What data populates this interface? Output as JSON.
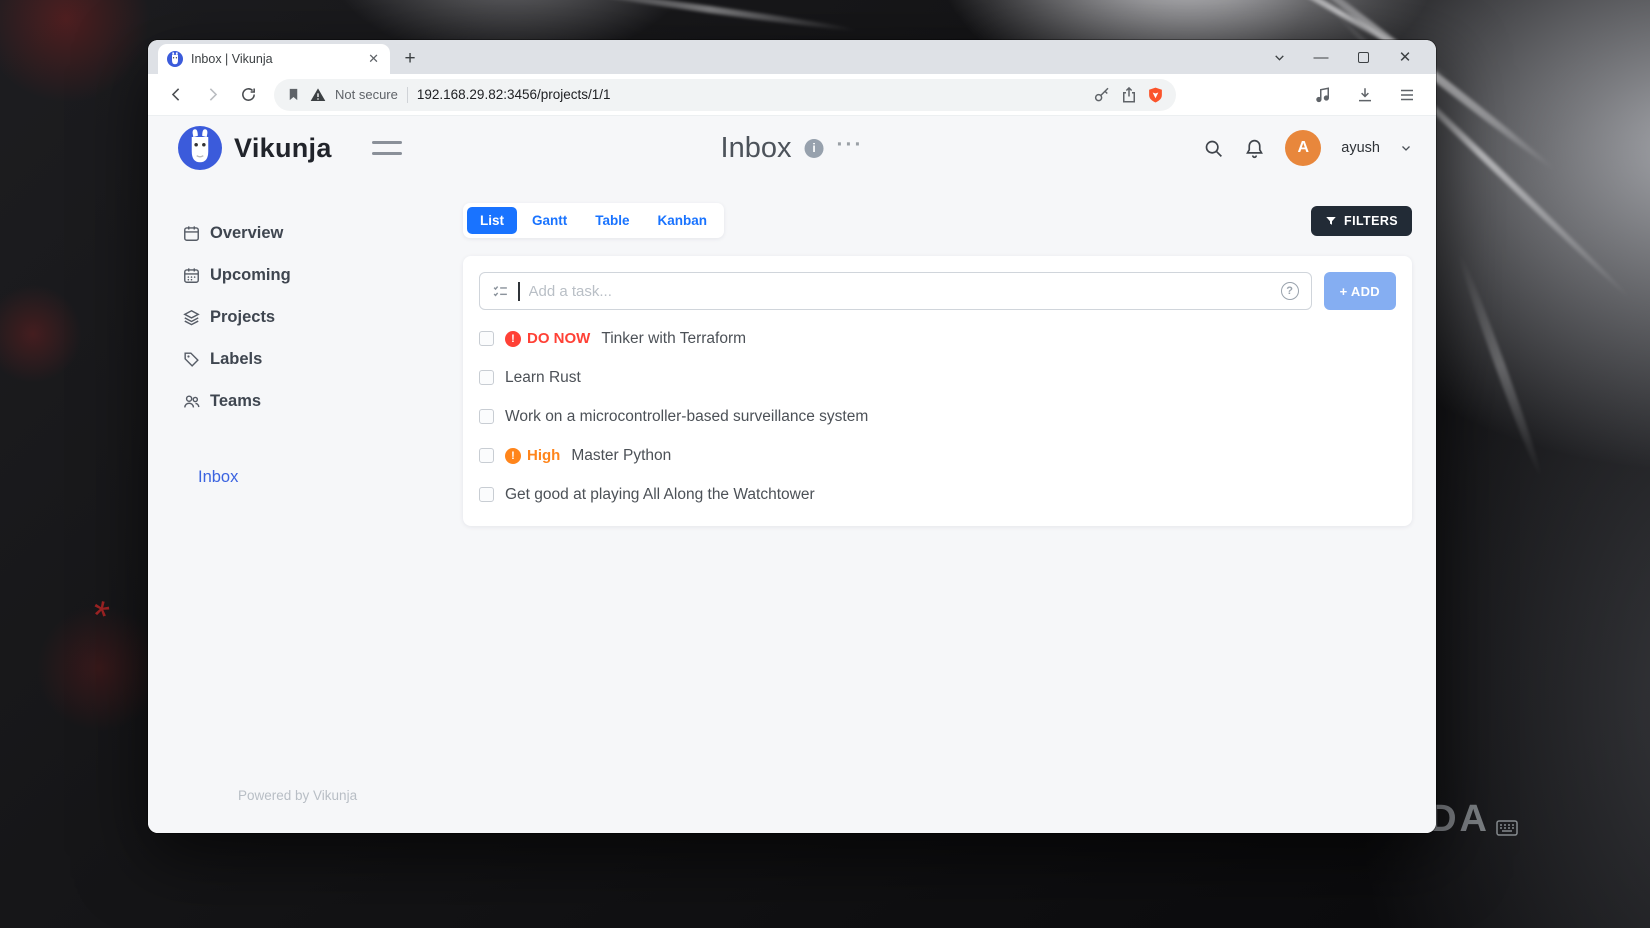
{
  "browser": {
    "tab_title": "Inbox | Vikunja",
    "new_tab_label": "+",
    "security_label": "Not secure",
    "url": "192.168.29.82:3456/projects/1/1"
  },
  "app": {
    "brand": "Vikunja",
    "page_title": "Inbox",
    "user_name": "ayush",
    "avatar_initial": "A",
    "sidebar": {
      "items": [
        {
          "label": "Overview"
        },
        {
          "label": "Upcoming"
        },
        {
          "label": "Projects"
        },
        {
          "label": "Labels"
        },
        {
          "label": "Teams"
        }
      ],
      "inbox_label": "Inbox",
      "footer": "Powered by Vikunja"
    },
    "views": [
      {
        "label": "List"
      },
      {
        "label": "Gantt"
      },
      {
        "label": "Table"
      },
      {
        "label": "Kanban"
      }
    ],
    "filters_label": "FILTERS",
    "add_task": {
      "placeholder": "Add a task...",
      "button_label": "+ ADD"
    },
    "tasks": [
      {
        "priority": "DO NOW",
        "title": "Tinker with Terraform"
      },
      {
        "priority": "",
        "title": "Learn Rust"
      },
      {
        "priority": "",
        "title": "Work on a microcontroller-based surveillance system"
      },
      {
        "priority": "High",
        "title": "Master Python"
      },
      {
        "priority": "",
        "title": "Get good at playing All Along the Watchtower"
      }
    ]
  },
  "colors": {
    "primary": "#1973ff",
    "priority_do_now": "#ff4136",
    "priority_high": "#ff851b",
    "filters_button_bg": "#222b36",
    "add_button_bg": "#85aef2",
    "avatar_bg": "#e8873c"
  },
  "watermark": "XDA"
}
